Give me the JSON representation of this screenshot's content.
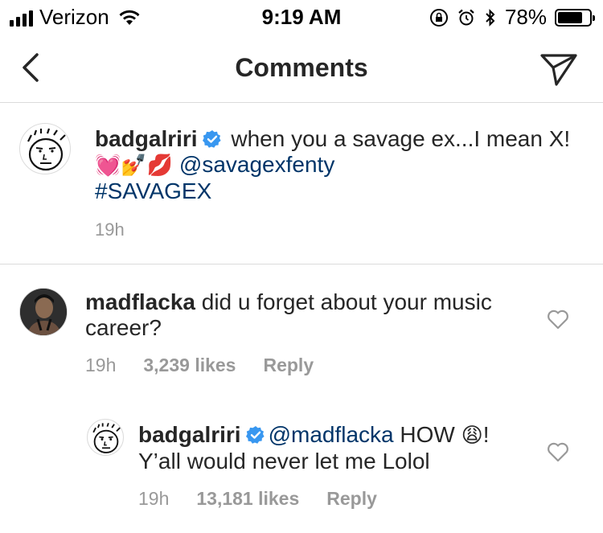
{
  "status_bar": {
    "carrier": "Verizon",
    "time": "9:19 AM",
    "battery": "78%",
    "battery_level": 0.78
  },
  "nav": {
    "title": "Comments"
  },
  "caption": {
    "username": "badgalriri",
    "text_before": " when you a savage ex...I mean X! ",
    "emojis": "💓💅💋",
    "mention": "@savagexfenty",
    "hashtag": "#SAVAGEX",
    "time": "19h"
  },
  "comments": [
    {
      "username": "madflacka",
      "text": " did u forget about your music career?",
      "time": "19h",
      "likes": "3,239 likes",
      "reply_label": "Reply"
    },
    {
      "username": "badgalriri",
      "mention": "@madflacka",
      "text_after_mention": " HOW ",
      "emoji": "😩",
      "text_end": "! Y’all would never let me Lolol",
      "time": "19h",
      "likes": "13,181 likes",
      "reply_label": "Reply"
    }
  ],
  "icons": {
    "back": "chevron-left-icon",
    "send": "paper-plane-icon",
    "verified": "verified-badge-icon",
    "like": "heart-outline-icon"
  },
  "colors": {
    "link": "#003569",
    "verified": "#3897f0",
    "secondary_text": "#999999",
    "divider": "#dbdbdb"
  }
}
